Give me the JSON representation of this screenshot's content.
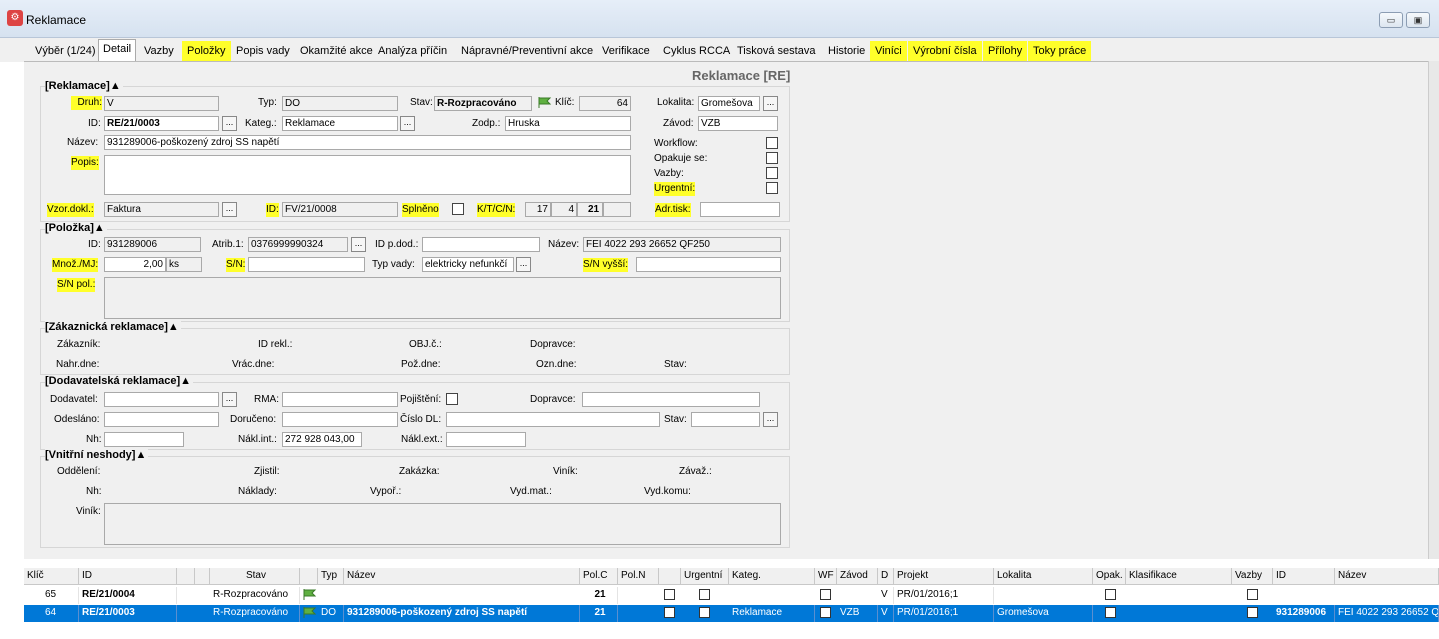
{
  "window": {
    "title": "Reklamace",
    "icon": "app-icon",
    "controls": [
      "minimize",
      "maximize"
    ]
  },
  "tabs": [
    {
      "label": "Výběr (1/24)",
      "highlight": false
    },
    {
      "label": "Detail",
      "highlight": false,
      "active": true
    },
    {
      "label": "Vazby",
      "highlight": false
    },
    {
      "label": "Položky",
      "highlight": true
    },
    {
      "label": "Popis vady",
      "highlight": false
    },
    {
      "label": "Okamžité akce",
      "highlight": false
    },
    {
      "label": "Analýza příčin",
      "highlight": false
    },
    {
      "label": "Nápravné/Preventivní akce",
      "highlight": false
    },
    {
      "label": "Verifikace",
      "highlight": false
    },
    {
      "label": "Cyklus RCCA",
      "highlight": false
    },
    {
      "label": "Tisková sestava",
      "highlight": false
    },
    {
      "label": "Historie",
      "highlight": false
    },
    {
      "label": "Viníci",
      "highlight": true
    },
    {
      "label": "Výrobní čísla",
      "highlight": true
    },
    {
      "label": "Přílohy",
      "highlight": true
    },
    {
      "label": "Toky práce",
      "highlight": true
    }
  ],
  "form_title": "Reklamace [RE]",
  "reklamace": {
    "section": "[Reklamace]▲",
    "druh_label": "Druh:",
    "druh": "V",
    "typ_label": "Typ:",
    "typ": "DO",
    "stav_label": "Stav:",
    "stav": "R-Rozpracováno",
    "klic_label": "Klíč:",
    "klic": "64",
    "lokalita_label": "Lokalita:",
    "lokalita": "Gromešova",
    "id_label": "ID:",
    "id": "RE/21/0003",
    "kateg_label": "Kateg.:",
    "kateg": "Reklamace",
    "zodp_label": "Zodp.:",
    "zodp": "Hruska",
    "zavod_label": "Závod:",
    "zavod": "VZB",
    "nazev_label": "Název:",
    "nazev": "931289006-poškozený zdroj SS napětí",
    "workflow_label": "Workflow:",
    "opakuje_label": "Opakuje se:",
    "vazby_label": "Vazby:",
    "urgentni_label": "Urgentní:",
    "popis_label": "Popis:",
    "popis": "",
    "vzor_label": "Vzor.dokl.:",
    "vzor": "Faktura",
    "id2_label": "ID:",
    "id2": "FV/21/0008",
    "splneno_label": "Splněno",
    "ktcn_label": "K/T/C/N:",
    "k": "17",
    "t": "4",
    "c": "21",
    "adrtisk_label": "Adr.tisk:",
    "adrtisk": ""
  },
  "polozka": {
    "section": "[Položka]▲",
    "id_label": "ID:",
    "id": "931289006",
    "atrib_label": "Atrib.1:",
    "atrib": "0376999990324",
    "idpdod_label": "ID p.dod.:",
    "idpdod": "",
    "nazev_label": "Název:",
    "nazev": "FEI 4022 293 26652 QF250",
    "mnoz_label": "Množ./MJ:",
    "mnoz": "2,00",
    "mj": "ks",
    "sn_label": "S/N:",
    "sn": "",
    "typvady_label": "Typ vady:",
    "typvady": "elektricky nefunkčí",
    "snvyssi_label": "S/N vyšší:",
    "snvyssi": "",
    "snpol_label": "S/N pol.:"
  },
  "zakaznicka": {
    "section": "[Zákaznická reklamace]▲",
    "labels": [
      "Zákazník:",
      "ID rekl.:",
      "OBJ.č.:",
      "Dopravce:",
      "Nahr.dne:",
      "Vrác.dne:",
      "Pož.dne:",
      "Ozn.dne:",
      "Stav:"
    ]
  },
  "dodavatelska": {
    "section": "[Dodavatelská reklamace]▲",
    "dodavatel_label": "Dodavatel:",
    "rma_label": "RMA:",
    "pojisteni_label": "Pojištění:",
    "dopravce_label": "Dopravce:",
    "odeslano_label": "Odesláno:",
    "doruceno_label": "Doručeno:",
    "cislodl_label": "Číslo DL:",
    "stav_label": "Stav:",
    "nh_label": "Nh:",
    "naklint_label": "Nákl.int.:",
    "naklint": "272 928 043,00",
    "naklext_label": "Nákl.ext.:"
  },
  "vnitrni": {
    "section": "[Vnitřní neshody]▲",
    "labels": [
      "Oddělení:",
      "Zjistil:",
      "Zakázka:",
      "Viník:",
      "Závaž.:",
      "Nh:",
      "Náklady:",
      "Vypoř.:",
      "Vyd.mat.:",
      "Vyd.komu:"
    ],
    "vinik_label": "Viník:"
  },
  "grid": {
    "headers": [
      "Klíč",
      "ID",
      "",
      "",
      "Stav",
      "",
      "Typ",
      "Název",
      "Pol.C",
      "Pol.N",
      "",
      "Urgentní",
      "Kateg.",
      "WF",
      "Závod",
      "D",
      "Projekt",
      "Lokalita",
      "Opak.",
      "Klasifikace",
      "Vazby",
      "ID",
      "Název"
    ],
    "rows": [
      {
        "klic": "65",
        "id": "RE/21/0004",
        "stav": "R-Rozpracováno",
        "typ": "",
        "nazev": "",
        "polc": "21",
        "kateg": "",
        "zavod": "",
        "d": "V",
        "projekt": "PR/01/2016;1",
        "lokalita": "",
        "id2": "",
        "nazev2": "",
        "selected": false
      },
      {
        "klic": "64",
        "id": "RE/21/0003",
        "stav": "R-Rozpracováno",
        "typ": "DO",
        "nazev": "931289006-poškozený zdroj SS napětí",
        "polc": "21",
        "kateg": "Reklamace",
        "zavod": "VZB",
        "d": "V",
        "projekt": "PR/01/2016;1",
        "lokalita": "Gromešova",
        "id2": "931289006",
        "nazev2": "FEI 4022 293 26652 QF250",
        "selected": true
      }
    ]
  },
  "colors": {
    "highlight": "#ffff2a",
    "selection": "#0078d7",
    "panel": "#f0f0f0",
    "flag": "#5fb041"
  }
}
